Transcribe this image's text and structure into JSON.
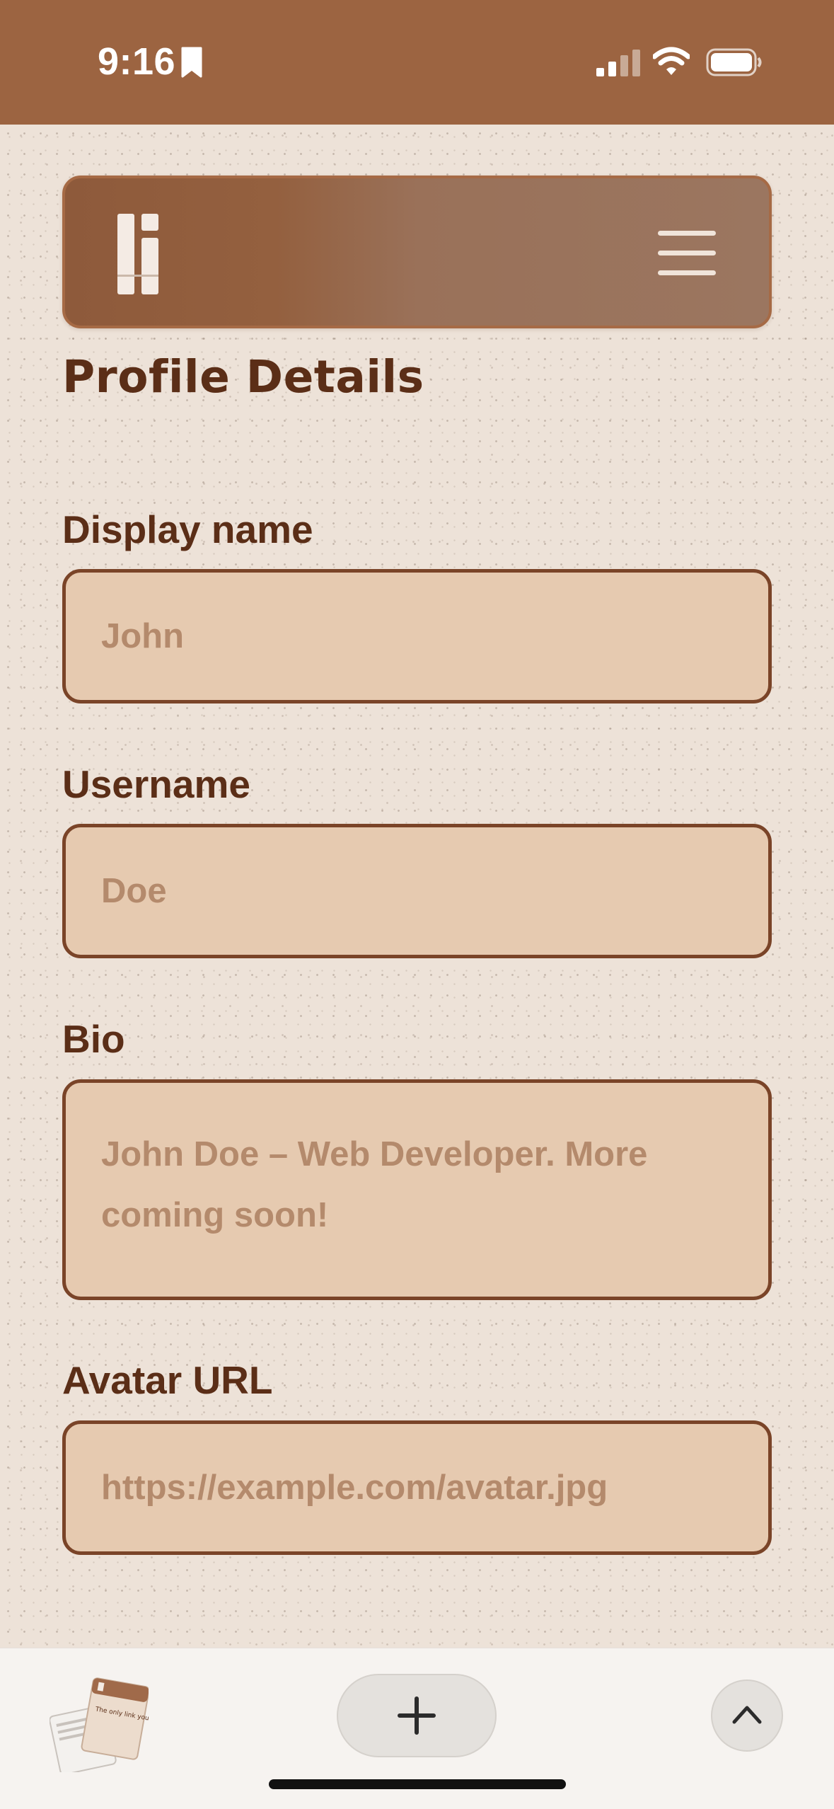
{
  "status_bar": {
    "time": "9:16"
  },
  "header": {
    "logo_icon": "logo-mark-icon",
    "menu_icon": "hamburger-menu-icon"
  },
  "page": {
    "title": "Profile Details"
  },
  "form": {
    "display_name": {
      "label": "Display name",
      "value": "John"
    },
    "username": {
      "label": "Username",
      "value": "Doe"
    },
    "bio": {
      "label": "Bio",
      "value": "John Doe – Web Developer. More coming soon!"
    },
    "avatar_url": {
      "label": "Avatar URL",
      "value": "https://example.com/avatar.jpg"
    }
  },
  "bottom_bar": {
    "tabs_icon": "tab-overview-thumbnail-icon",
    "tabs_thumbnail_text": "The only link you will ever need.",
    "new_tab_icon": "plus-icon",
    "scroll_top_icon": "chevron-up-icon"
  },
  "colors": {
    "status_bar_bg": "#9c6441",
    "page_bg": "#ede2d8",
    "title_text": "#5b2e17",
    "field_bg": "#e6cab0",
    "field_border": "#7a4428",
    "field_text": "#b48a6c"
  }
}
